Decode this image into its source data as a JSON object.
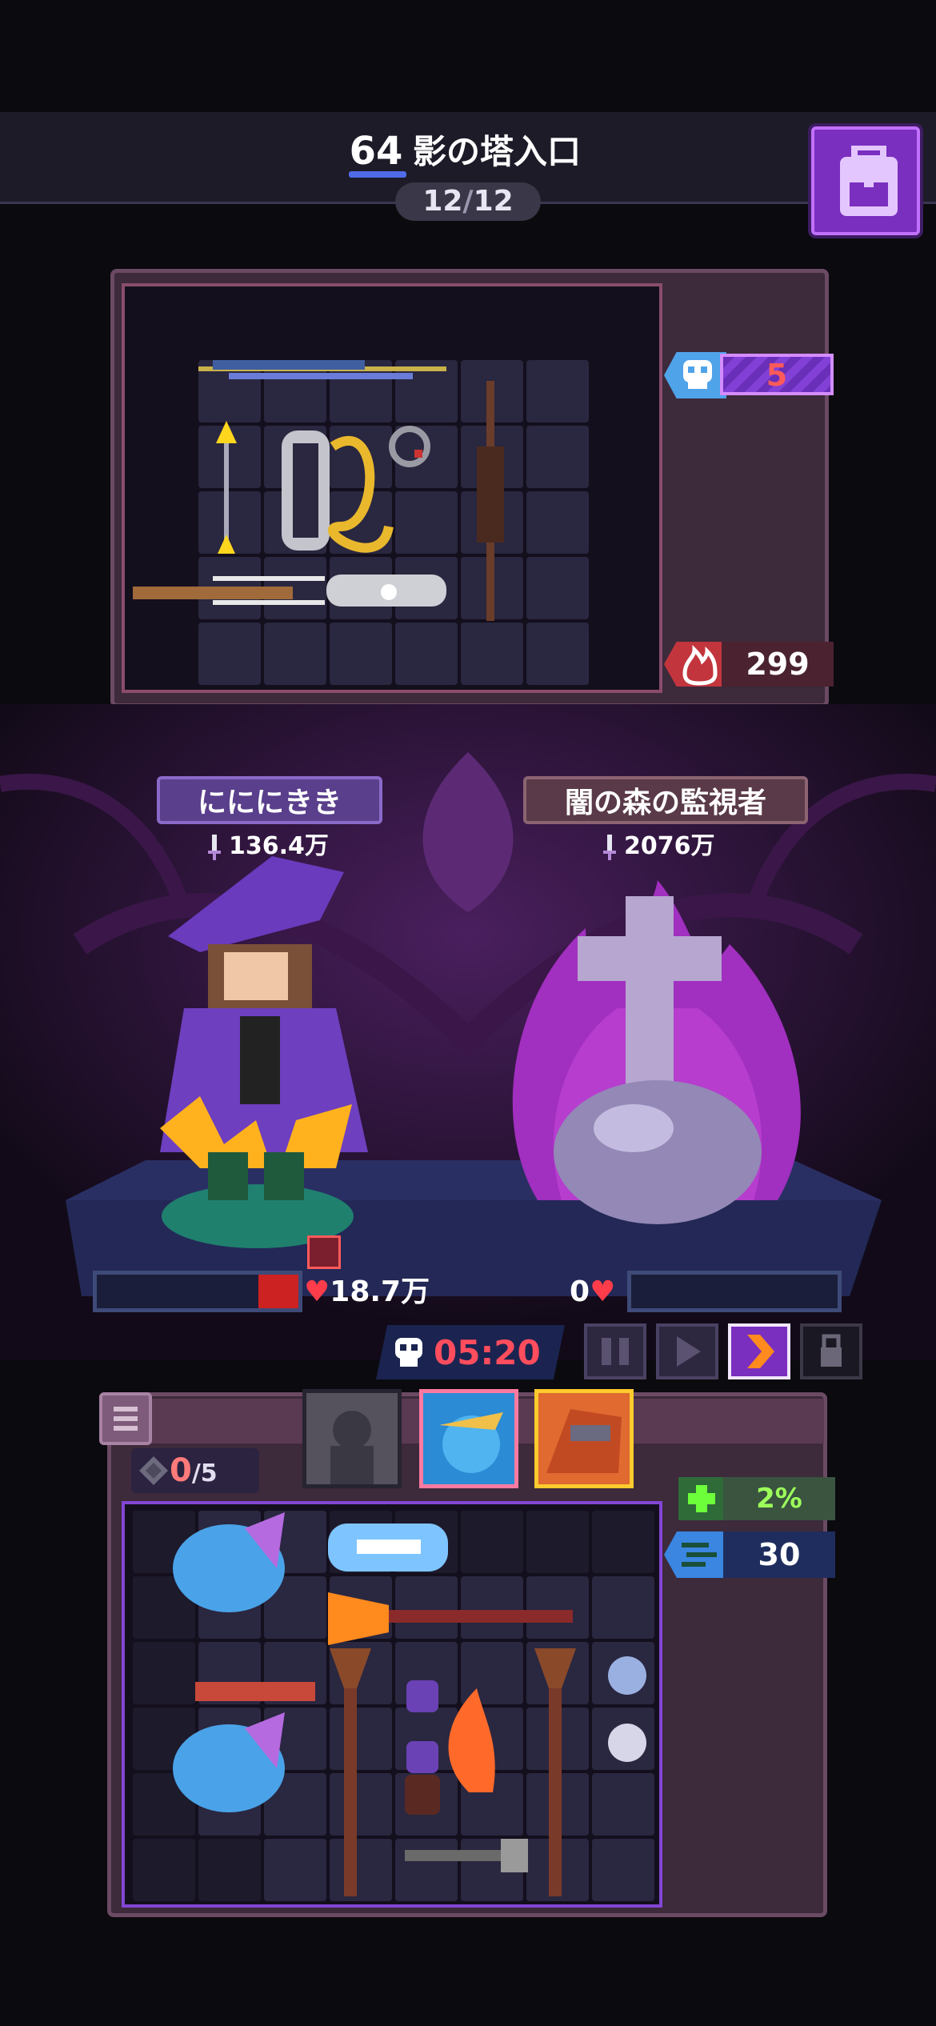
{
  "header": {
    "level": "64",
    "stage_title": "影の塔入口",
    "progress_current": "12",
    "progress_separator": "/",
    "progress_total": "12"
  },
  "enemy_panel": {
    "skull_count": "5",
    "fire_count": "299"
  },
  "battle": {
    "player_name": "にににきき",
    "player_power": "136.4万",
    "enemy_name": "闇の森の監視者",
    "enemy_power": "2076万",
    "player_hp": "18.7万",
    "enemy_hp": "0",
    "player_hp_fraction": 0.2,
    "enemy_hp_fraction": 0.0,
    "timer": "05:20"
  },
  "player_panel": {
    "slots_used": "0",
    "slots_total": "/5",
    "heal_percent": "2%",
    "wind_count": "30"
  },
  "colors": {
    "accent_purple": "#7a2fbf",
    "timer_red": "#ff4d5e",
    "hp_red": "#cc2222",
    "heal_green": "#9cff5a"
  },
  "icons": [
    "backpack-icon",
    "skull-icon",
    "fire-icon",
    "sword-icon",
    "heart-icon",
    "pause-icon",
    "play-icon",
    "fast-forward-icon",
    "lock-icon",
    "list-icon",
    "gem-icon",
    "heal-plus-icon",
    "wind-icon"
  ]
}
